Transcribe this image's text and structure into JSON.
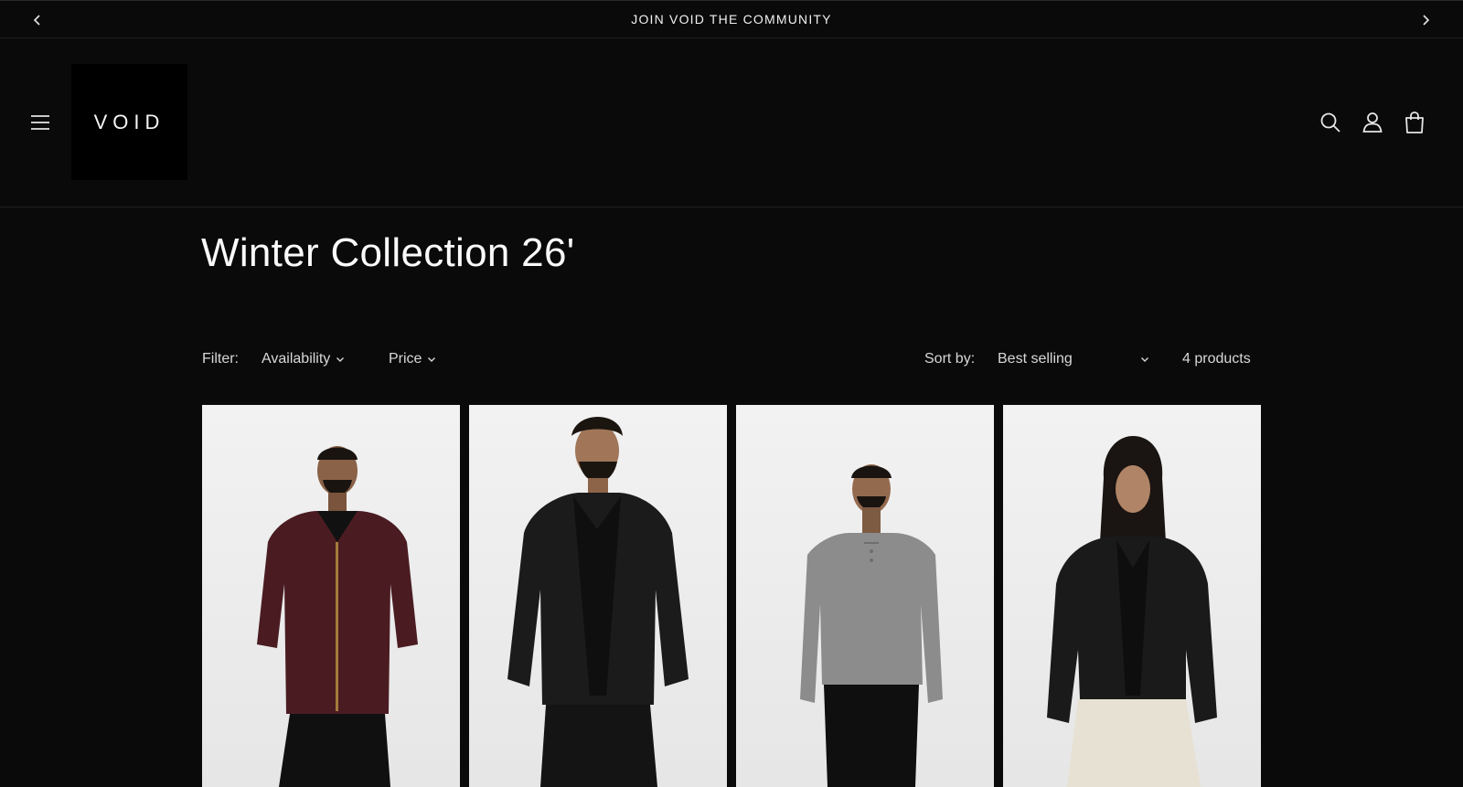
{
  "announcement": {
    "text": "JOIN VOID THE COMMUNITY"
  },
  "header": {
    "logo": "VOID",
    "icons": [
      "menu-icon",
      "search-icon",
      "account-icon",
      "cart-icon"
    ]
  },
  "collection": {
    "title": "Winter Collection 26'"
  },
  "toolbar": {
    "filter_label": "Filter:",
    "filters": [
      "Availability",
      "Price"
    ],
    "sort_label": "Sort by:",
    "sort_value": "Best selling",
    "product_count": "4 products"
  },
  "products": [
    {
      "image": "burgundy leather jacket",
      "accent": "#4a1c22"
    },
    {
      "image": "black wool jacket",
      "accent": "#1b1b1b"
    },
    {
      "image": "grey henley sweater",
      "accent": "#8c8c8c"
    },
    {
      "image": "black jacket with cream pants",
      "accent": "#1a1a1a"
    }
  ]
}
